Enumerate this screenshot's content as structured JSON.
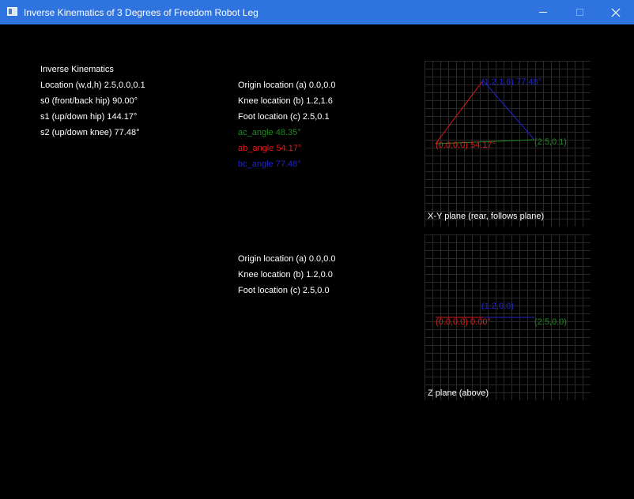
{
  "window": {
    "title": "Inverse Kinematics of 3 Degrees of Freedom Robot Leg"
  },
  "left_panel": {
    "heading": "Inverse Kinematics",
    "location": "Location (w,d,h) 2.5,0.0,0.1",
    "s0": "s0 (front/back hip) 90.00°",
    "s1": "s1 (up/down hip) 144.17°",
    "s2": "s2 (up/down knee) 77.48°"
  },
  "xy_panel": {
    "origin": "Origin location (a) 0.0,0.0",
    "knee": "Knee location (b) 1.2,1.6",
    "foot": "Foot location (c) 2.5,0.1",
    "ac_angle": "ac_angle 48.35°",
    "ab_angle": "ab_angle 54.17°",
    "bc_angle": "bc_angle 77.48°"
  },
  "z_panel": {
    "origin": "Origin location (a) 0.0,0.0",
    "knee": "Knee location (b) 1.2,0.0",
    "foot": "Foot location (c) 2.5,0.0"
  },
  "plots": {
    "xy": {
      "caption": "X-Y plane (rear, follows plane)",
      "knee_label": "(1.2,1.6) 77.48°",
      "origin_label": "(0.0,0.0) 54.17°",
      "foot_label": "(2.5,0.1)",
      "points": {
        "a": [
          0.0,
          0.0
        ],
        "b": [
          1.2,
          1.6
        ],
        "c": [
          2.5,
          0.1
        ]
      }
    },
    "z": {
      "caption": "Z plane (above)",
      "knee_label": "(1.2,0.0)",
      "origin_label": "(0.0,0.0) 0.00°",
      "foot_label": "(2.5,0.0)",
      "points": {
        "a": [
          0.0,
          0.0
        ],
        "b": [
          1.2,
          0.0
        ],
        "c": [
          2.5,
          0.0
        ]
      }
    }
  },
  "colors": {
    "titlebar": "#2f74de",
    "background": "#000000",
    "text": "#ffffff",
    "segment_ab": "#e01b1b",
    "segment_bc": "#1f23c9",
    "segment_ac": "#1f8a1f",
    "grid": "#2a2a2a"
  }
}
